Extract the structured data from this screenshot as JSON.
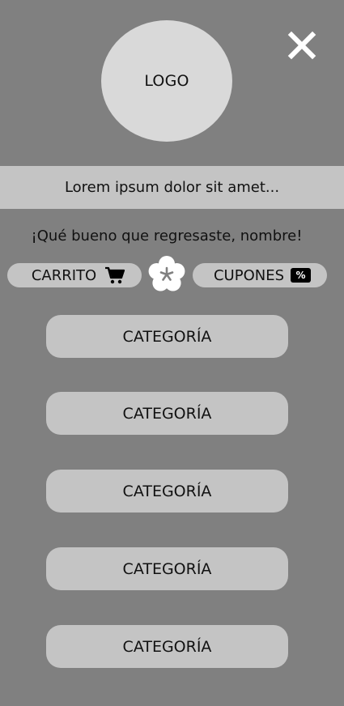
{
  "header": {
    "logo_text": "LOGO",
    "close_icon": "close-icon"
  },
  "banner": {
    "text": "Lorem ipsum dolor sit amet..."
  },
  "greeting": {
    "text": "¡Qué bueno que regresaste, nombre!"
  },
  "quick_actions": {
    "cart": {
      "label": "CARRITO",
      "icon": "cart-icon"
    },
    "center": {
      "icon": "flower-icon"
    },
    "coupons": {
      "label": "CUPONES",
      "icon": "percent-icon",
      "icon_text": "%"
    }
  },
  "categories": [
    {
      "label": "CATEGORÍA"
    },
    {
      "label": "CATEGORÍA"
    },
    {
      "label": "CATEGORÍA"
    },
    {
      "label": "CATEGORÍA"
    },
    {
      "label": "CATEGORÍA"
    }
  ],
  "colors": {
    "background": "#808080",
    "panel": "#c4c4c4",
    "logo": "#d9d9d9"
  }
}
